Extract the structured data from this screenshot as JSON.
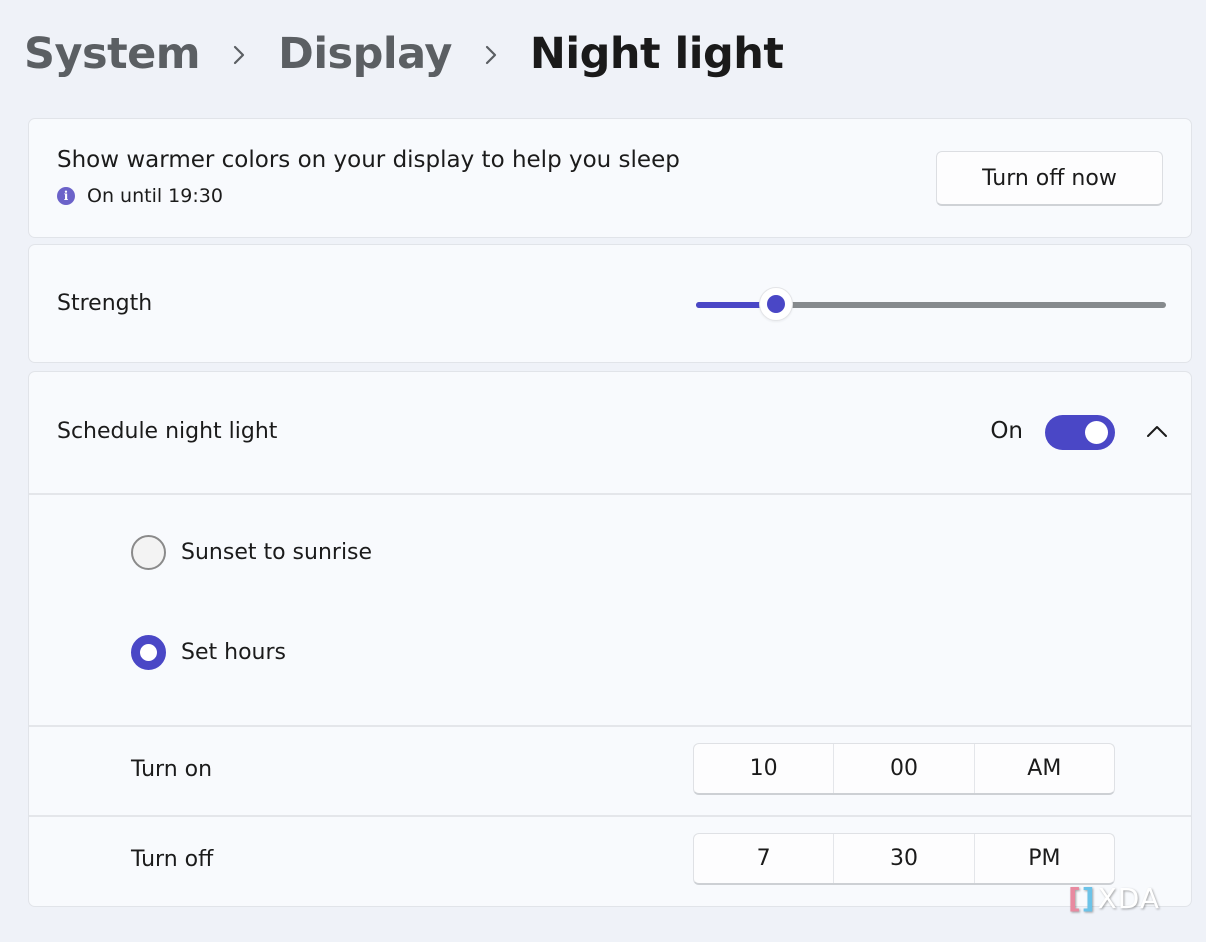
{
  "breadcrumb": {
    "items": [
      "System",
      "Display",
      "Night light"
    ],
    "separator_icon": "chevron-right-icon"
  },
  "status_card": {
    "description": "Show warmer colors on your display to help you sleep",
    "status_icon": "info-icon",
    "status_icon_glyph": "i",
    "status_text": "On until 19:30",
    "button_label": "Turn off now"
  },
  "strength": {
    "label": "Strength",
    "value_percent": 17
  },
  "schedule": {
    "label": "Schedule night light",
    "toggle_state_label": "On",
    "toggle_on": true,
    "expanded": true,
    "options": [
      {
        "label": "Sunset to sunrise",
        "selected": false
      },
      {
        "label": "Set hours",
        "selected": true
      }
    ],
    "turn_on": {
      "label": "Turn on",
      "hour": "10",
      "minute": "00",
      "period": "AM"
    },
    "turn_off": {
      "label": "Turn off",
      "hour": "7",
      "minute": "30",
      "period": "PM"
    }
  },
  "colors": {
    "accent": "#4a47c6",
    "info_icon": "#6b62c9",
    "page_background": "#eff2f8",
    "card_background": "#f8fafd"
  },
  "watermark": {
    "left_bracket": "[",
    "right_bracket": "]",
    "text": "XDA"
  }
}
